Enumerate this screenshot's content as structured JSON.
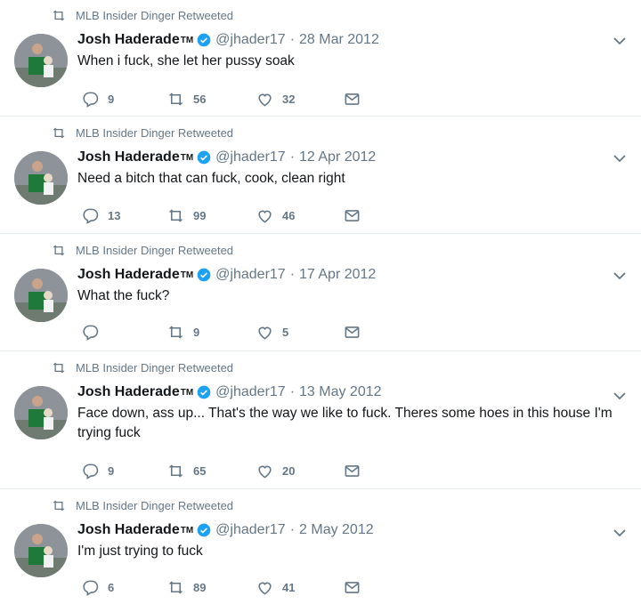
{
  "tweets": [
    {
      "retweeted_by": "MLB Insider Dinger Retweeted",
      "name": "Josh Haderade",
      "tm": "TM",
      "handle": "@jhader17",
      "date": "28 Mar 2012",
      "text": "When i fuck, she let her pussy soak",
      "replies": "9",
      "retweets": "56",
      "likes": "32"
    },
    {
      "retweeted_by": "MLB Insider Dinger Retweeted",
      "name": "Josh Haderade",
      "tm": "TM",
      "handle": "@jhader17",
      "date": "12 Apr 2012",
      "text": "Need a bitch that can fuck, cook, clean right",
      "replies": "13",
      "retweets": "99",
      "likes": "46"
    },
    {
      "retweeted_by": "MLB Insider Dinger Retweeted",
      "name": "Josh Haderade",
      "tm": "TM",
      "handle": "@jhader17",
      "date": "17 Apr 2012",
      "text": "What the fuck?",
      "replies": "",
      "retweets": "9",
      "likes": "5"
    },
    {
      "retweeted_by": "MLB Insider Dinger Retweeted",
      "name": "Josh Haderade",
      "tm": "TM",
      "handle": "@jhader17",
      "date": "13 May 2012",
      "text": "Face down, ass up... That's the way we like to fuck. Theres some hoes in this house I'm trying fuck",
      "replies": "9",
      "retweets": "65",
      "likes": "20"
    },
    {
      "retweeted_by": "MLB Insider Dinger Retweeted",
      "name": "Josh Haderade",
      "tm": "TM",
      "handle": "@jhader17",
      "date": "2 May 2012",
      "text": "I'm just trying to fuck",
      "replies": "6",
      "retweets": "89",
      "likes": "41"
    }
  ],
  "sep": "·",
  "colors": {
    "verified": "#1da1f2",
    "meta": "#657786",
    "divider": "#e6ecf0"
  },
  "icons": [
    "retweet-icon",
    "verified-badge-icon",
    "chevron-down-icon",
    "reply-icon",
    "heart-icon",
    "direct-message-icon"
  ]
}
